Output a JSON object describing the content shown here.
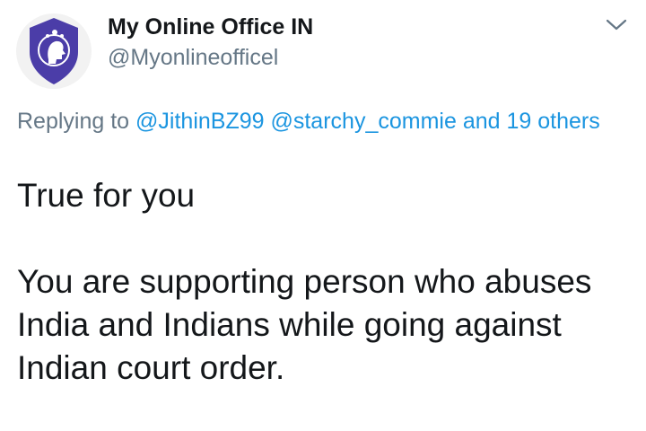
{
  "author": {
    "display_name": "My Online Office IN",
    "handle": "@Myonlineofficel",
    "avatar_mark": "N"
  },
  "reply": {
    "prefix": "Replying to",
    "mentions": [
      "@JithinBZ99",
      "@starchy_commie"
    ],
    "others": "and 19 others"
  },
  "tweet": {
    "line1": "True for you",
    "line2": "You are supporting person who abuses India and Indians while going against Indian court order."
  },
  "icons": {
    "more": "chevron-down-icon"
  },
  "colors": {
    "link": "#1b95e0",
    "secondary": "#657786",
    "text": "#14171a",
    "avatar_shield": "#4b3da8"
  }
}
